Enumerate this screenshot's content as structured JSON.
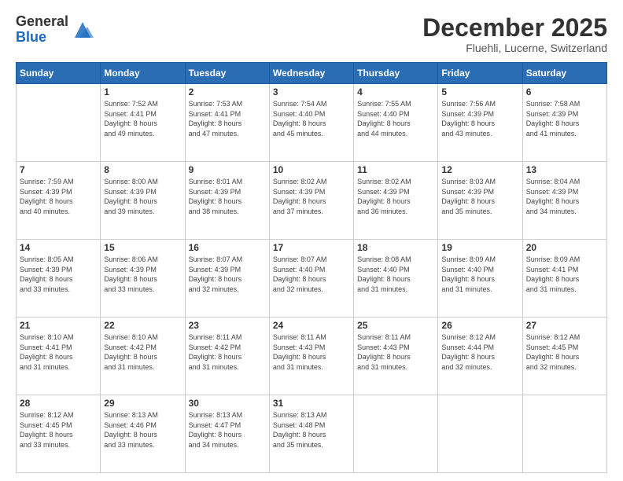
{
  "logo": {
    "general": "General",
    "blue": "Blue"
  },
  "header": {
    "month": "December 2025",
    "location": "Fluehli, Lucerne, Switzerland"
  },
  "weekdays": [
    "Sunday",
    "Monday",
    "Tuesday",
    "Wednesday",
    "Thursday",
    "Friday",
    "Saturday"
  ],
  "weeks": [
    [
      {
        "day": "",
        "info": ""
      },
      {
        "day": "1",
        "info": "Sunrise: 7:52 AM\nSunset: 4:41 PM\nDaylight: 8 hours\nand 49 minutes."
      },
      {
        "day": "2",
        "info": "Sunrise: 7:53 AM\nSunset: 4:41 PM\nDaylight: 8 hours\nand 47 minutes."
      },
      {
        "day": "3",
        "info": "Sunrise: 7:54 AM\nSunset: 4:40 PM\nDaylight: 8 hours\nand 45 minutes."
      },
      {
        "day": "4",
        "info": "Sunrise: 7:55 AM\nSunset: 4:40 PM\nDaylight: 8 hours\nand 44 minutes."
      },
      {
        "day": "5",
        "info": "Sunrise: 7:56 AM\nSunset: 4:39 PM\nDaylight: 8 hours\nand 43 minutes."
      },
      {
        "day": "6",
        "info": "Sunrise: 7:58 AM\nSunset: 4:39 PM\nDaylight: 8 hours\nand 41 minutes."
      }
    ],
    [
      {
        "day": "7",
        "info": "Sunrise: 7:59 AM\nSunset: 4:39 PM\nDaylight: 8 hours\nand 40 minutes."
      },
      {
        "day": "8",
        "info": "Sunrise: 8:00 AM\nSunset: 4:39 PM\nDaylight: 8 hours\nand 39 minutes."
      },
      {
        "day": "9",
        "info": "Sunrise: 8:01 AM\nSunset: 4:39 PM\nDaylight: 8 hours\nand 38 minutes."
      },
      {
        "day": "10",
        "info": "Sunrise: 8:02 AM\nSunset: 4:39 PM\nDaylight: 8 hours\nand 37 minutes."
      },
      {
        "day": "11",
        "info": "Sunrise: 8:02 AM\nSunset: 4:39 PM\nDaylight: 8 hours\nand 36 minutes."
      },
      {
        "day": "12",
        "info": "Sunrise: 8:03 AM\nSunset: 4:39 PM\nDaylight: 8 hours\nand 35 minutes."
      },
      {
        "day": "13",
        "info": "Sunrise: 8:04 AM\nSunset: 4:39 PM\nDaylight: 8 hours\nand 34 minutes."
      }
    ],
    [
      {
        "day": "14",
        "info": "Sunrise: 8:05 AM\nSunset: 4:39 PM\nDaylight: 8 hours\nand 33 minutes."
      },
      {
        "day": "15",
        "info": "Sunrise: 8:06 AM\nSunset: 4:39 PM\nDaylight: 8 hours\nand 33 minutes."
      },
      {
        "day": "16",
        "info": "Sunrise: 8:07 AM\nSunset: 4:39 PM\nDaylight: 8 hours\nand 32 minutes."
      },
      {
        "day": "17",
        "info": "Sunrise: 8:07 AM\nSunset: 4:40 PM\nDaylight: 8 hours\nand 32 minutes."
      },
      {
        "day": "18",
        "info": "Sunrise: 8:08 AM\nSunset: 4:40 PM\nDaylight: 8 hours\nand 31 minutes."
      },
      {
        "day": "19",
        "info": "Sunrise: 8:09 AM\nSunset: 4:40 PM\nDaylight: 8 hours\nand 31 minutes."
      },
      {
        "day": "20",
        "info": "Sunrise: 8:09 AM\nSunset: 4:41 PM\nDaylight: 8 hours\nand 31 minutes."
      }
    ],
    [
      {
        "day": "21",
        "info": "Sunrise: 8:10 AM\nSunset: 4:41 PM\nDaylight: 8 hours\nand 31 minutes."
      },
      {
        "day": "22",
        "info": "Sunrise: 8:10 AM\nSunset: 4:42 PM\nDaylight: 8 hours\nand 31 minutes."
      },
      {
        "day": "23",
        "info": "Sunrise: 8:11 AM\nSunset: 4:42 PM\nDaylight: 8 hours\nand 31 minutes."
      },
      {
        "day": "24",
        "info": "Sunrise: 8:11 AM\nSunset: 4:43 PM\nDaylight: 8 hours\nand 31 minutes."
      },
      {
        "day": "25",
        "info": "Sunrise: 8:11 AM\nSunset: 4:43 PM\nDaylight: 8 hours\nand 31 minutes."
      },
      {
        "day": "26",
        "info": "Sunrise: 8:12 AM\nSunset: 4:44 PM\nDaylight: 8 hours\nand 32 minutes."
      },
      {
        "day": "27",
        "info": "Sunrise: 8:12 AM\nSunset: 4:45 PM\nDaylight: 8 hours\nand 32 minutes."
      }
    ],
    [
      {
        "day": "28",
        "info": "Sunrise: 8:12 AM\nSunset: 4:45 PM\nDaylight: 8 hours\nand 33 minutes."
      },
      {
        "day": "29",
        "info": "Sunrise: 8:13 AM\nSunset: 4:46 PM\nDaylight: 8 hours\nand 33 minutes."
      },
      {
        "day": "30",
        "info": "Sunrise: 8:13 AM\nSunset: 4:47 PM\nDaylight: 8 hours\nand 34 minutes."
      },
      {
        "day": "31",
        "info": "Sunrise: 8:13 AM\nSunset: 4:48 PM\nDaylight: 8 hours\nand 35 minutes."
      },
      {
        "day": "",
        "info": ""
      },
      {
        "day": "",
        "info": ""
      },
      {
        "day": "",
        "info": ""
      }
    ]
  ]
}
